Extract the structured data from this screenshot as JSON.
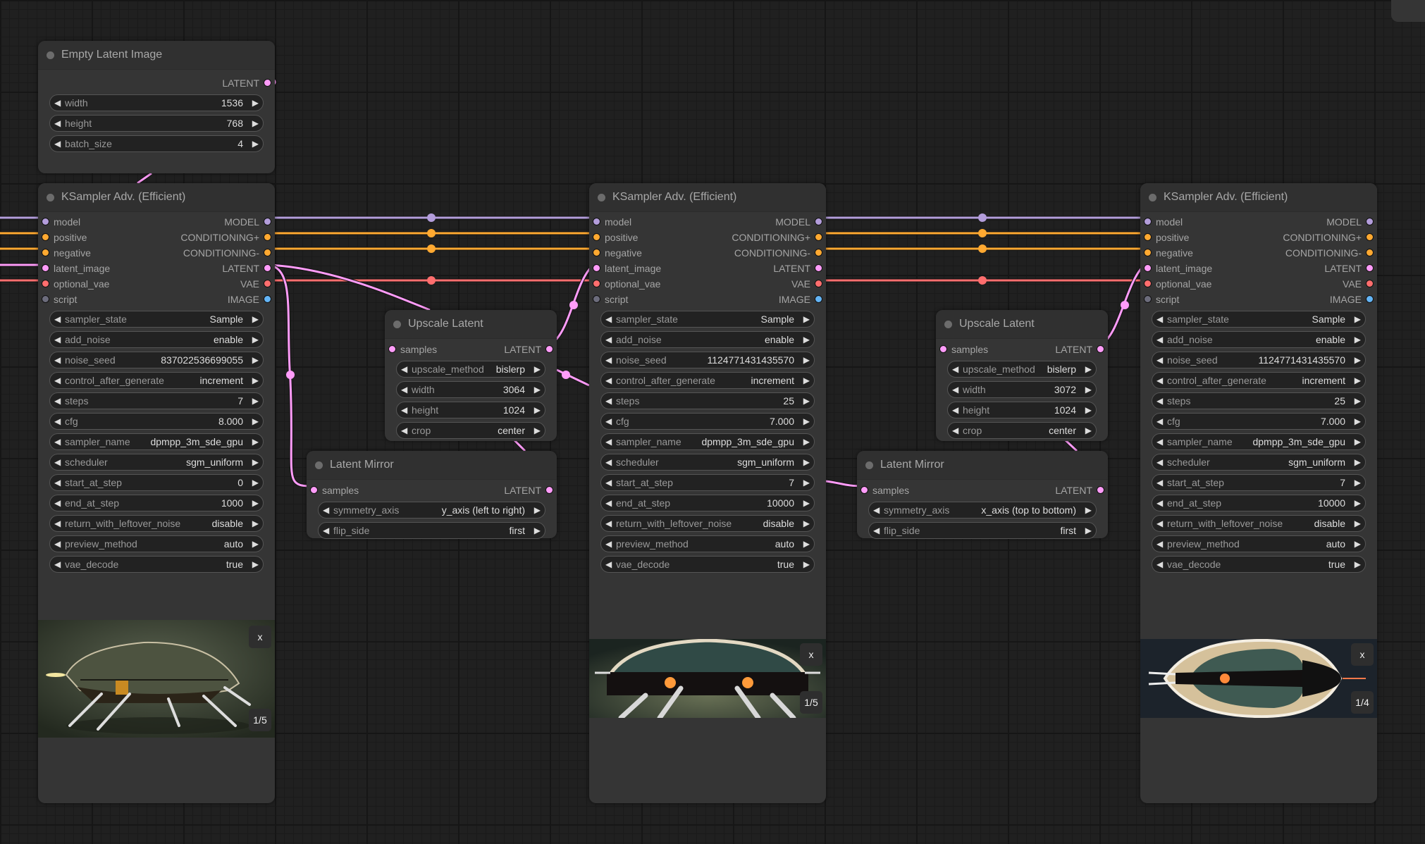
{
  "app": "ComfyUI node graph",
  "colors": {
    "model": "#b39ddb",
    "conditioning": "#ffa931",
    "latent": "#ff9cf9",
    "vae": "#ff6e6e",
    "image": "#64b5f6",
    "script": "#6c6c7c",
    "node_bg": "#353535",
    "canvas_bg": "#202020"
  },
  "empty_latent": {
    "title": "Empty Latent Image",
    "output": "LATENT",
    "widgets": [
      {
        "label": "width",
        "value": "1536"
      },
      {
        "label": "height",
        "value": "768"
      },
      {
        "label": "batch_size",
        "value": "4"
      }
    ]
  },
  "ksamplers": [
    {
      "title": "KSampler Adv. (Efficient)",
      "inputs": [
        "model",
        "positive",
        "negative",
        "latent_image",
        "optional_vae",
        "script"
      ],
      "outputs": [
        "MODEL",
        "CONDITIONING+",
        "CONDITIONING-",
        "LATENT",
        "VAE",
        "IMAGE"
      ],
      "widgets": [
        {
          "label": "sampler_state",
          "value": "Sample"
        },
        {
          "label": "add_noise",
          "value": "enable"
        },
        {
          "label": "noise_seed",
          "value": "837022536699055"
        },
        {
          "label": "control_after_generate",
          "value": "increment"
        },
        {
          "label": "steps",
          "value": "7"
        },
        {
          "label": "cfg",
          "value": "8.000"
        },
        {
          "label": "sampler_name",
          "value": "dpmpp_3m_sde_gpu"
        },
        {
          "label": "scheduler",
          "value": "sgm_uniform"
        },
        {
          "label": "start_at_step",
          "value": "0"
        },
        {
          "label": "end_at_step",
          "value": "1000"
        },
        {
          "label": "return_with_leftover_noise",
          "value": "disable"
        },
        {
          "label": "preview_method",
          "value": "auto"
        },
        {
          "label": "vae_decode",
          "value": "true"
        }
      ],
      "preview": {
        "close_label": "x",
        "counter": "1/5",
        "subject": "side view of beetle-like spaceship"
      }
    },
    {
      "title": "KSampler Adv. (Efficient)",
      "inputs": [
        "model",
        "positive",
        "negative",
        "latent_image",
        "optional_vae",
        "script"
      ],
      "outputs": [
        "MODEL",
        "CONDITIONING+",
        "CONDITIONING-",
        "LATENT",
        "VAE",
        "IMAGE"
      ],
      "widgets": [
        {
          "label": "sampler_state",
          "value": "Sample"
        },
        {
          "label": "add_noise",
          "value": "enable"
        },
        {
          "label": "noise_seed",
          "value": "1124771431435570"
        },
        {
          "label": "control_after_generate",
          "value": "increment"
        },
        {
          "label": "steps",
          "value": "25"
        },
        {
          "label": "cfg",
          "value": "7.000"
        },
        {
          "label": "sampler_name",
          "value": "dpmpp_3m_sde_gpu"
        },
        {
          "label": "scheduler",
          "value": "sgm_uniform"
        },
        {
          "label": "start_at_step",
          "value": "7"
        },
        {
          "label": "end_at_step",
          "value": "10000"
        },
        {
          "label": "return_with_leftover_noise",
          "value": "disable"
        },
        {
          "label": "preview_method",
          "value": "auto"
        },
        {
          "label": "vae_decode",
          "value": "true"
        }
      ],
      "preview": {
        "close_label": "x",
        "counter": "1/5",
        "subject": "front view of symmetric spaceship"
      }
    },
    {
      "title": "KSampler Adv. (Efficient)",
      "inputs": [
        "model",
        "positive",
        "negative",
        "latent_image",
        "optional_vae",
        "script"
      ],
      "outputs": [
        "MODEL",
        "CONDITIONING+",
        "CONDITIONING-",
        "LATENT",
        "VAE",
        "IMAGE"
      ],
      "widgets": [
        {
          "label": "sampler_state",
          "value": "Sample"
        },
        {
          "label": "add_noise",
          "value": "enable"
        },
        {
          "label": "noise_seed",
          "value": "1124771431435570"
        },
        {
          "label": "control_after_generate",
          "value": "increment"
        },
        {
          "label": "steps",
          "value": "25"
        },
        {
          "label": "cfg",
          "value": "7.000"
        },
        {
          "label": "sampler_name",
          "value": "dpmpp_3m_sde_gpu"
        },
        {
          "label": "scheduler",
          "value": "sgm_uniform"
        },
        {
          "label": "start_at_step",
          "value": "7"
        },
        {
          "label": "end_at_step",
          "value": "10000"
        },
        {
          "label": "return_with_leftover_noise",
          "value": "disable"
        },
        {
          "label": "preview_method",
          "value": "auto"
        },
        {
          "label": "vae_decode",
          "value": "true"
        }
      ],
      "preview": {
        "close_label": "x",
        "counter": "1/4",
        "subject": "top-down view of mirrored spaceship"
      }
    }
  ],
  "upscales": [
    {
      "title": "Upscale Latent",
      "input": "samples",
      "output": "LATENT",
      "widgets": [
        {
          "label": "upscale_method",
          "value": "bislerp"
        },
        {
          "label": "width",
          "value": "3064"
        },
        {
          "label": "height",
          "value": "1024"
        },
        {
          "label": "crop",
          "value": "center"
        }
      ]
    },
    {
      "title": "Upscale Latent",
      "input": "samples",
      "output": "LATENT",
      "widgets": [
        {
          "label": "upscale_method",
          "value": "bislerp"
        },
        {
          "label": "width",
          "value": "3072"
        },
        {
          "label": "height",
          "value": "1024"
        },
        {
          "label": "crop",
          "value": "center"
        }
      ]
    }
  ],
  "mirrors": [
    {
      "title": "Latent Mirror",
      "input": "samples",
      "output": "LATENT",
      "widgets": [
        {
          "label": "symmetry_axis",
          "value": "y_axis (left to right)"
        },
        {
          "label": "flip_side",
          "value": "first"
        }
      ]
    },
    {
      "title": "Latent Mirror",
      "input": "samples",
      "output": "LATENT",
      "widgets": [
        {
          "label": "symmetry_axis",
          "value": "x_axis (top to bottom)"
        },
        {
          "label": "flip_side",
          "value": "first"
        }
      ]
    }
  ]
}
